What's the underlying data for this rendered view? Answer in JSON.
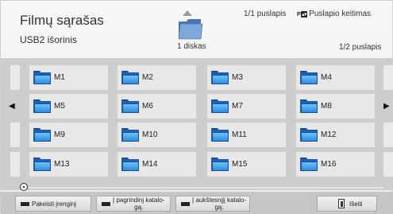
{
  "header": {
    "title": "Filmų sąrašas",
    "device": "USB2 išorinis",
    "page_indicator": "1/1 puslapis",
    "page_change_label": "Puslapio keitimas",
    "page_change_key": "P",
    "disk_label": "1 diskas",
    "page_right": "1/2 puslapis"
  },
  "grid": {
    "items": [
      {
        "label": "M1"
      },
      {
        "label": "M2"
      },
      {
        "label": "M3"
      },
      {
        "label": "M4"
      },
      {
        "label": "M5"
      },
      {
        "label": "M6"
      },
      {
        "label": "M7"
      },
      {
        "label": "M8"
      },
      {
        "label": "M9"
      },
      {
        "label": "M10"
      },
      {
        "label": "M11"
      },
      {
        "label": "M12"
      },
      {
        "label": "M13"
      },
      {
        "label": "M14"
      },
      {
        "label": "M15"
      },
      {
        "label": "M16"
      }
    ],
    "nav_left_glyph": "◀",
    "nav_right_glyph": "▶"
  },
  "slider": {
    "value": 0
  },
  "buttons": {
    "change_device": "Pakeisti įrenginį",
    "to_root_line1": "Į pagrindinį katalo-",
    "to_root_line2": "gą.",
    "to_parent_line1": "Į aukštesnįjį katalo-",
    "to_parent_line2": "gą.",
    "exit": "Išeiti"
  },
  "colors": {
    "folder_blue": "#2f8be0",
    "grid_background": "#cdcdcd"
  }
}
